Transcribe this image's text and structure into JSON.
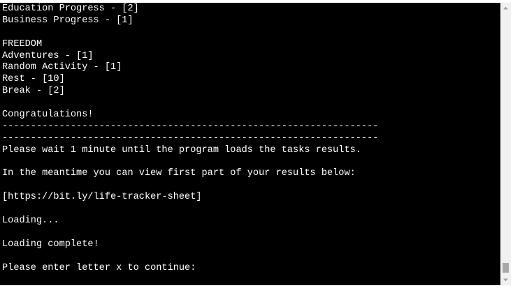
{
  "terminal": {
    "lines": [
      "Education Progress - [2]",
      "Business Progress - [1]",
      "",
      "FREEDOM",
      "Adventures - [1]",
      "Random Activity - [1]",
      "Rest - [10]",
      "Break - [2]",
      "",
      "Congratulations!",
      "------------------------------------------------------------------",
      "------------------------------------------------------------------",
      "Please wait 1 minute until the program loads the tasks results.",
      "",
      "In the meantime you can view first part of your results below:",
      "",
      "[https://bit.ly/life-tracker-sheet]",
      "",
      "Loading...",
      "",
      "Loading complete!",
      "",
      "Please enter letter x to continue:"
    ]
  },
  "scrollbar": {
    "up_icon": "chevron-up-icon",
    "down_icon": "chevron-down-icon",
    "scroll_position": 1.0
  },
  "colors": {
    "terminal_bg": "#000000",
    "terminal_text": "#ffffff",
    "scrollbar_track": "#f1f1f1",
    "scrollbar_thumb": "#a8a8a8"
  }
}
